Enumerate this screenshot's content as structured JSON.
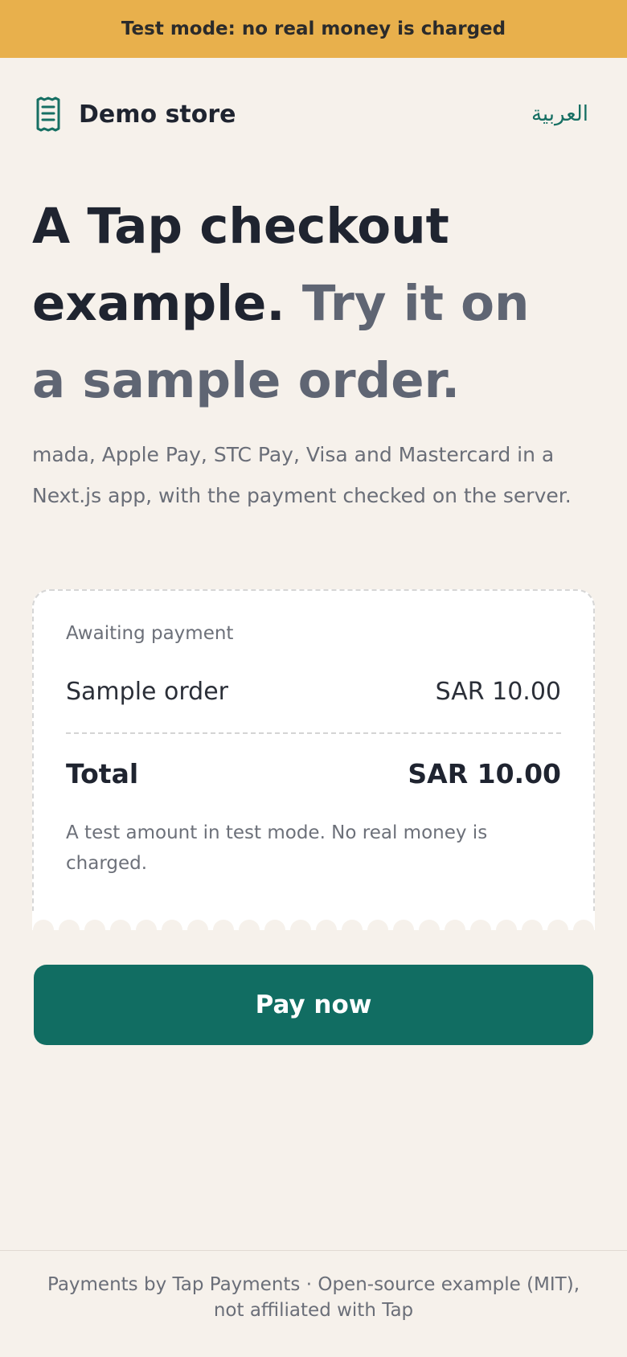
{
  "banner": {
    "text": "Test mode: no real money is charged"
  },
  "header": {
    "brand_name": "Demo store",
    "language_link": "العربية",
    "brand_icon": "receipt-icon"
  },
  "hero": {
    "title_main": "A Tap checkout example.",
    "title_sub": "Try it on a sample order.",
    "intro": "mada, Apple Pay, STC Pay, Visa and Mastercard in a Next.js app, with the payment checked on the server."
  },
  "order_card": {
    "status": "Awaiting payment",
    "item_label": "Sample order",
    "item_amount": "SAR 10.00",
    "total_label": "Total",
    "total_amount": "SAR 10.00",
    "note": "A test amount in test mode. No real money is charged."
  },
  "pay_button": {
    "label": "Pay now"
  },
  "footer": {
    "text": "Payments by Tap Payments · Open-source example (MIT), not affiliated with Tap"
  },
  "colors": {
    "background": "#f6f1eb",
    "banner": "#e8b04c",
    "accent": "#116d62",
    "text_primary": "#1f2430",
    "text_muted": "#5f6573"
  }
}
